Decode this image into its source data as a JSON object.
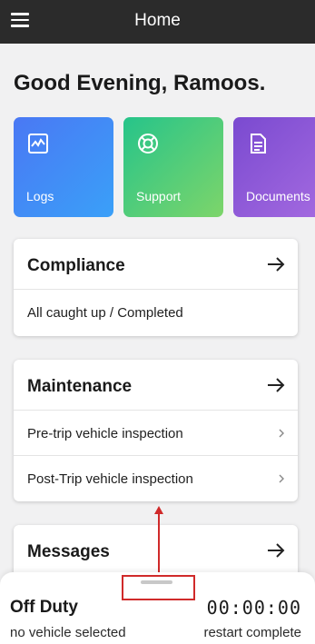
{
  "header": {
    "title": "Home"
  },
  "greeting": "Good Evening, Ramoos.",
  "tiles": [
    {
      "label": "Logs",
      "icon": "chart-icon",
      "color": "#4a78f4"
    },
    {
      "label": "Support",
      "icon": "lifebuoy-icon",
      "color": "#26c48a"
    },
    {
      "label": "Documents",
      "icon": "document-icon",
      "color": "#7a4ad0"
    }
  ],
  "compliance": {
    "title": "Compliance",
    "status": "All caught up / Completed"
  },
  "maintenance": {
    "title": "Maintenance",
    "items": [
      "Pre-trip vehicle inspection",
      "Post-Trip vehicle inspection"
    ]
  },
  "messages": {
    "title": "Messages"
  },
  "bottom_sheet": {
    "duty_status": "Off Duty",
    "timer": "00:00:00",
    "vehicle": "no vehicle selected",
    "restart": "restart complete"
  },
  "annotation_color": "#d02a2a"
}
